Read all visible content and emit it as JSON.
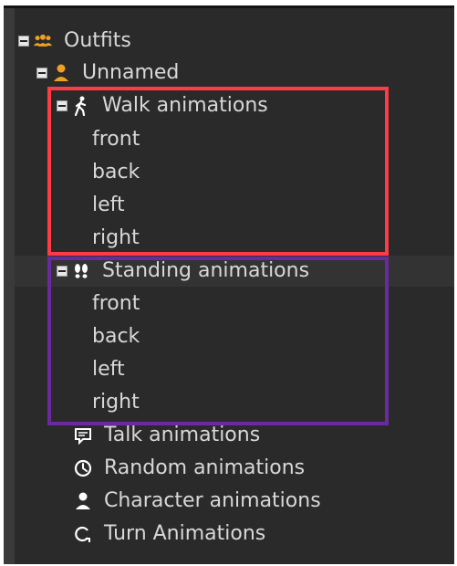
{
  "tree": {
    "outfits_label": "Outfits",
    "unnamed_label": "Unnamed",
    "walk": {
      "label": "Walk animations",
      "children": [
        "front",
        "back",
        "left",
        "right"
      ]
    },
    "standing": {
      "label": "Standing animations",
      "children": [
        "front",
        "back",
        "left",
        "right"
      ]
    },
    "talk_label": "Talk animations",
    "random_label": "Random animations",
    "character_label": "Character animations",
    "turn_label": "Turn Animations"
  },
  "colors": {
    "walk_highlight": "#ff3b45",
    "standing_highlight": "#6a2aa0",
    "icon_accent": "#f0a020"
  }
}
